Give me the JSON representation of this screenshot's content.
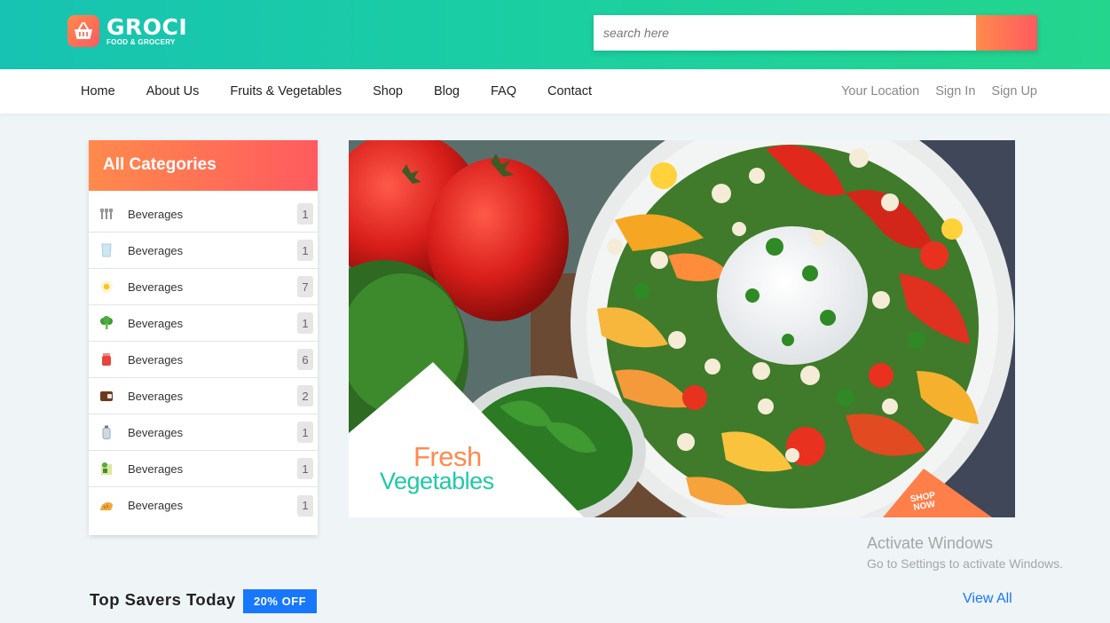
{
  "brand": {
    "name": "GROCI",
    "tagline": "FOOD & GROCERY"
  },
  "search": {
    "placeholder": "search here"
  },
  "nav": {
    "links": [
      "Home",
      "About Us",
      "Fruits & Vegetables",
      "Shop",
      "Blog",
      "FAQ",
      "Contact"
    ],
    "right": [
      "Your Location",
      "Sign In",
      "Sign Up"
    ]
  },
  "sidebar": {
    "title": "All Categories",
    "items": [
      {
        "label": "Beverages",
        "count": "1",
        "icon": "utensils-icon"
      },
      {
        "label": "Beverages",
        "count": "1",
        "icon": "water-glass-icon"
      },
      {
        "label": "Beverages",
        "count": "7",
        "icon": "egg-icon"
      },
      {
        "label": "Beverages",
        "count": "1",
        "icon": "broccoli-icon"
      },
      {
        "label": "Beverages",
        "count": "6",
        "icon": "jam-jar-icon"
      },
      {
        "label": "Beverages",
        "count": "2",
        "icon": "wallet-icon"
      },
      {
        "label": "Beverages",
        "count": "1",
        "icon": "bottle-icon"
      },
      {
        "label": "Beverages",
        "count": "1",
        "icon": "grocery-bag-icon"
      },
      {
        "label": "Beverages",
        "count": "1",
        "icon": "bread-icon"
      }
    ]
  },
  "hero": {
    "line1": "Fresh",
    "line2": "Vegetables",
    "cta_line1": "SHOP",
    "cta_line2": "NOW"
  },
  "watermark": {
    "title": "Activate Windows",
    "subtitle": "Go to Settings to activate Windows."
  },
  "savers": {
    "title": "Top Savers Today",
    "badge": "20% OFF",
    "view_all": "View All"
  },
  "colors": {
    "header_start": "#17c3b2",
    "header_end": "#23d58d",
    "accent_orange": "#ff8a4c",
    "accent_red": "#ff5a5f",
    "badge_blue": "#1777ff",
    "link_blue": "#1677ff"
  }
}
